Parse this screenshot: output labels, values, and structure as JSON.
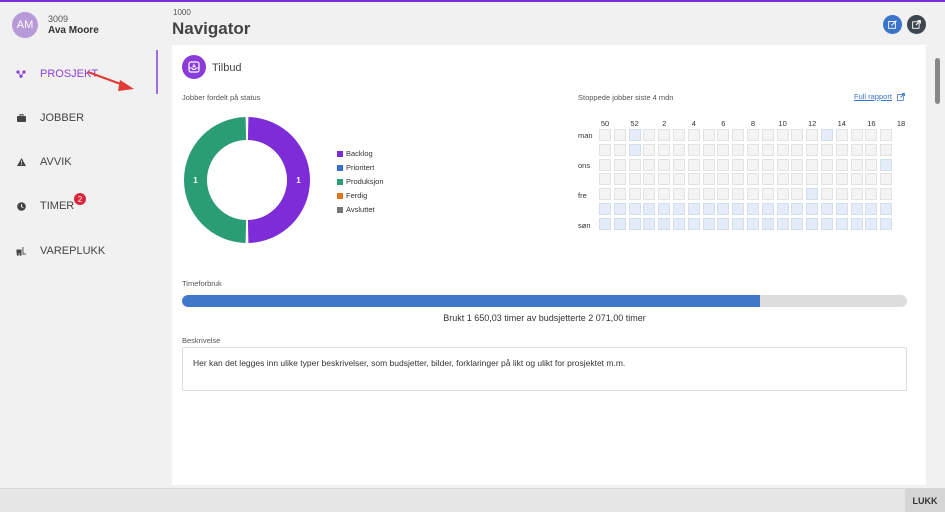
{
  "user": {
    "initials": "AM",
    "id": "3009",
    "name": "Ava Moore"
  },
  "sidebar": {
    "items": [
      {
        "label": "PROSJEKT",
        "icon": "project-icon",
        "active": true
      },
      {
        "label": "JOBBER",
        "icon": "briefcase-icon"
      },
      {
        "label": "AVVIK",
        "icon": "warning-icon"
      },
      {
        "label": "TIMER",
        "icon": "clock-icon",
        "badge": "2"
      },
      {
        "label": "VAREPLUKK",
        "icon": "forklift-icon"
      }
    ]
  },
  "header": {
    "id": "1000",
    "title": "Navigator"
  },
  "card": {
    "title": "Tilbud",
    "status_chart_label": "Jobber fordelt på status",
    "heatmap_label": "Stoppede jobber siste 4 mdn",
    "full_report_label": "Full rapport",
    "timeforbruk_label": "Timeforbruk",
    "progress_text": "Brukt 1 650,03 timer av budsjetterte 2 071,00 timer",
    "progress_fraction": 0.797,
    "description_label": "Beskrivelse",
    "description": "Her kan det legges inn ulike typer beskrivelser, som budsjetter, bilder, forklaringer på likt og ulikt for prosjektet m.m."
  },
  "chart_data": [
    {
      "type": "pie",
      "title": "Jobber fordelt på status",
      "categories": [
        "Backlog",
        "Prioritert",
        "Produksjon",
        "Ferdig",
        "Avsluttet"
      ],
      "values": [
        1,
        0,
        1,
        0,
        0
      ],
      "colors": [
        "#7d2cd8",
        "#3b6fcd",
        "#2a9d74",
        "#e4731b",
        "#777777"
      ],
      "legend": "right"
    },
    {
      "type": "heatmap",
      "title": "Stoppede jobber siste 4 mdn",
      "x_tick_labels": [
        "50",
        "52",
        "2",
        "4",
        "6",
        "8",
        "10",
        "12",
        "14",
        "16",
        "18"
      ],
      "y_tick_labels": [
        "man",
        "ons",
        "fre",
        "søn"
      ],
      "highlighted": [
        [
          0,
          2
        ],
        [
          0,
          15
        ],
        [
          1,
          2
        ],
        [
          2,
          19
        ],
        [
          4,
          14
        ],
        [
          5,
          0
        ],
        [
          5,
          1
        ],
        [
          5,
          2
        ],
        [
          5,
          3
        ],
        [
          5,
          4
        ],
        [
          5,
          5
        ],
        [
          5,
          6
        ],
        [
          5,
          7
        ],
        [
          5,
          8
        ],
        [
          5,
          9
        ],
        [
          5,
          10
        ],
        [
          5,
          11
        ],
        [
          5,
          12
        ],
        [
          5,
          13
        ],
        [
          5,
          14
        ],
        [
          5,
          15
        ],
        [
          5,
          16
        ],
        [
          5,
          17
        ],
        [
          5,
          18
        ],
        [
          5,
          19
        ],
        [
          6,
          0
        ],
        [
          6,
          1
        ],
        [
          6,
          2
        ],
        [
          6,
          3
        ],
        [
          6,
          4
        ],
        [
          6,
          5
        ],
        [
          6,
          6
        ],
        [
          6,
          7
        ],
        [
          6,
          8
        ],
        [
          6,
          9
        ],
        [
          6,
          10
        ],
        [
          6,
          11
        ],
        [
          6,
          12
        ],
        [
          6,
          13
        ],
        [
          6,
          14
        ],
        [
          6,
          15
        ],
        [
          6,
          16
        ],
        [
          6,
          17
        ],
        [
          6,
          18
        ],
        [
          6,
          19
        ]
      ]
    }
  ],
  "footer": {
    "close_label": "LUKK"
  }
}
